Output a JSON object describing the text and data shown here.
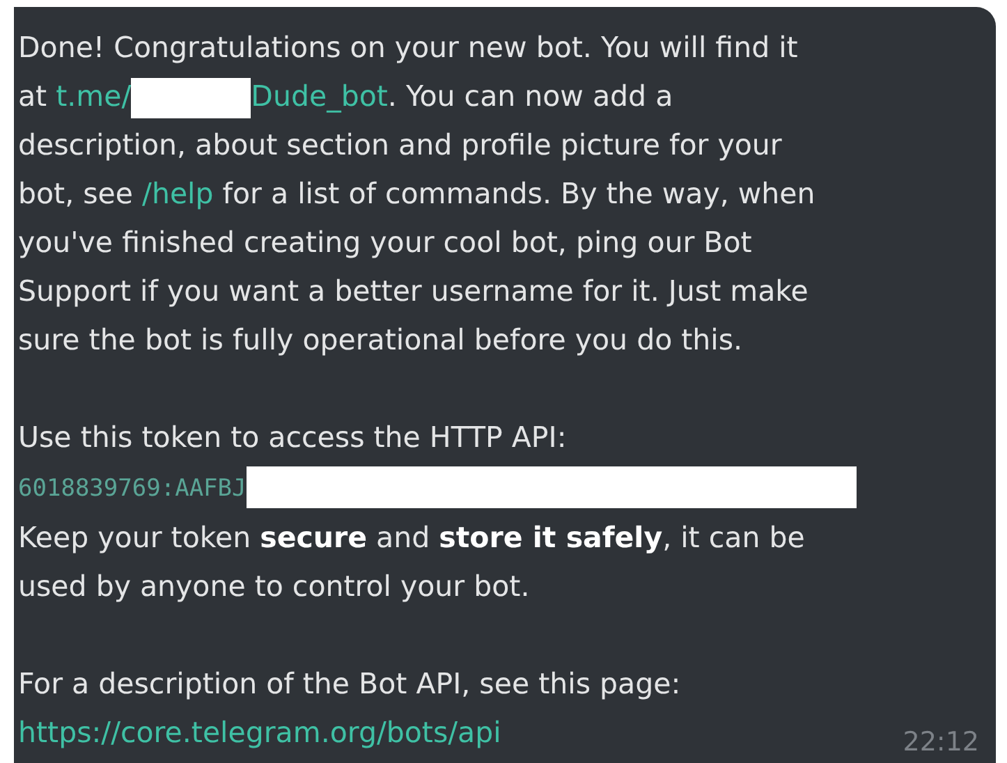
{
  "message": {
    "paragraphs": [
      {
        "segments": [
          {
            "kind": "text",
            "text": "Done! Congratulations on your new bot. You will find it\nat "
          },
          {
            "kind": "link",
            "text": "t.me/"
          },
          {
            "kind": "redaction"
          },
          {
            "kind": "link",
            "text": "Dude_bot"
          },
          {
            "kind": "text",
            "text": ". You can now add a\ndescription, about section and profile picture for your\nbot, see "
          },
          {
            "kind": "link",
            "text": "/help"
          },
          {
            "kind": "text",
            "text": " for a list of commands. By the way, when\nyou've finished creating your cool bot, ping our Bot\nSupport if you want a better username for it. Just make\nsure the bot is fully operational before you do this."
          }
        ]
      },
      {
        "segments": [
          {
            "kind": "text",
            "text": "Use this token to access the HTTP API:\n"
          },
          {
            "kind": "code",
            "text": "6018839769:AAFBJ"
          },
          {
            "kind": "redaction"
          },
          {
            "kind": "text",
            "text": "\nKeep your token **secure** and **store it safely**, it can be\nused by anyone to control your bot."
          }
        ]
      },
      {
        "segments": [
          {
            "kind": "text",
            "text": "For a description of the Bot API, see this page:\n"
          },
          {
            "kind": "link",
            "text": "https://core.telegram.org/bots/api"
          }
        ]
      }
    ],
    "time": "22:12"
  }
}
